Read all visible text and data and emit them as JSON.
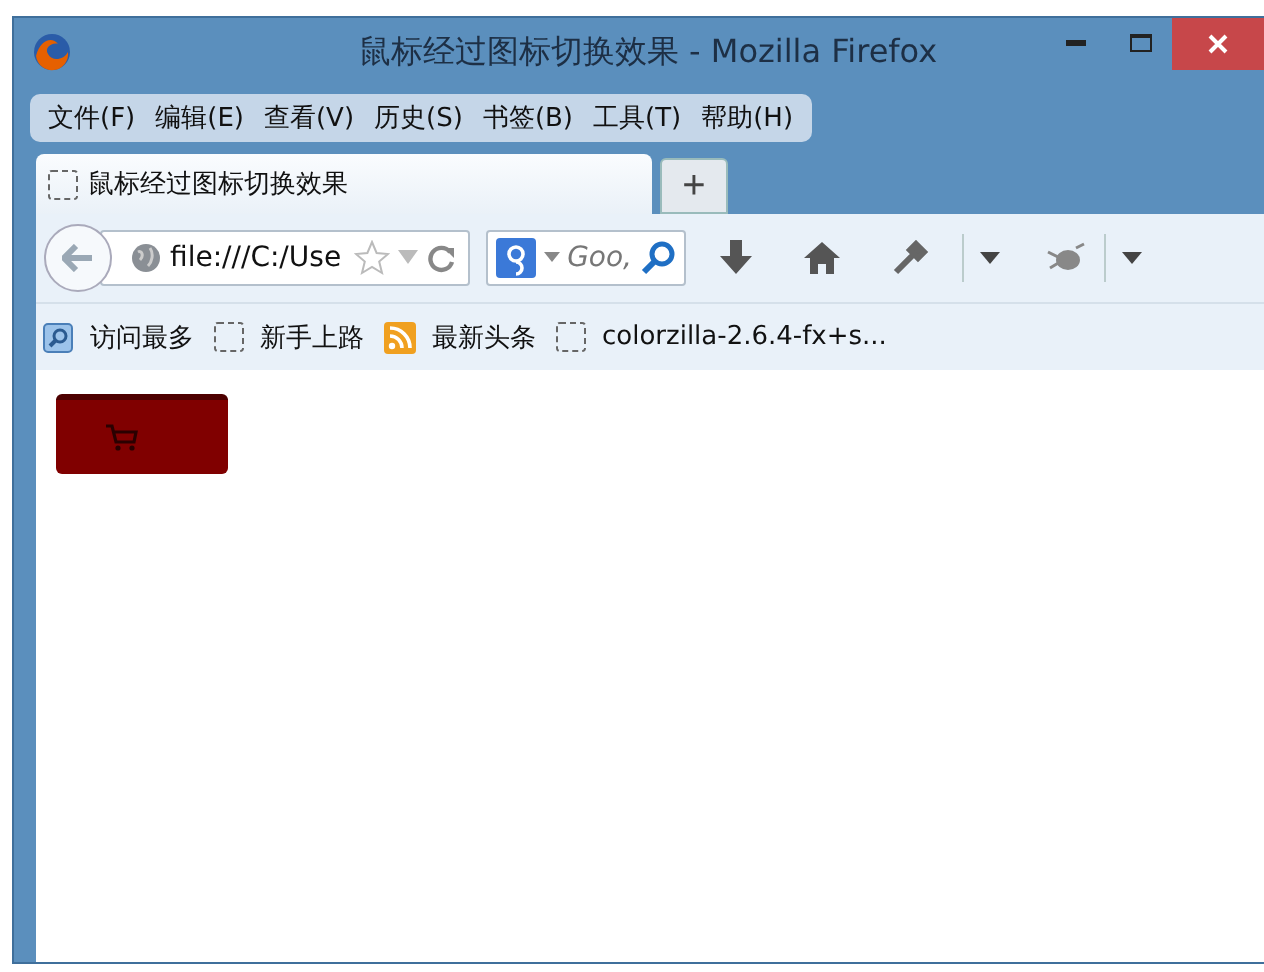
{
  "window": {
    "title": "鼠标经过图标切换效果 - Mozilla Firefox"
  },
  "menu": [
    {
      "label": "文件(F)"
    },
    {
      "label": "编辑(E)"
    },
    {
      "label": "查看(V)"
    },
    {
      "label": "历史(S)"
    },
    {
      "label": "书签(B)"
    },
    {
      "label": "工具(T)"
    },
    {
      "label": "帮助(H)"
    }
  ],
  "tabs": [
    {
      "label": "鼠标经过图标切换效果",
      "selected": true
    }
  ],
  "new_tab": "+",
  "url_field": {
    "value": "file:///C:/Use"
  },
  "search_field": {
    "placeholder": "Goo,"
  },
  "bookmarks": [
    {
      "label": "访问最多",
      "kind": "folder"
    },
    {
      "label": "新手上路",
      "kind": "page"
    },
    {
      "label": "最新头条",
      "kind": "feed"
    },
    {
      "label": "colorzilla-2.6.4-fx+s...",
      "kind": "page"
    }
  ]
}
